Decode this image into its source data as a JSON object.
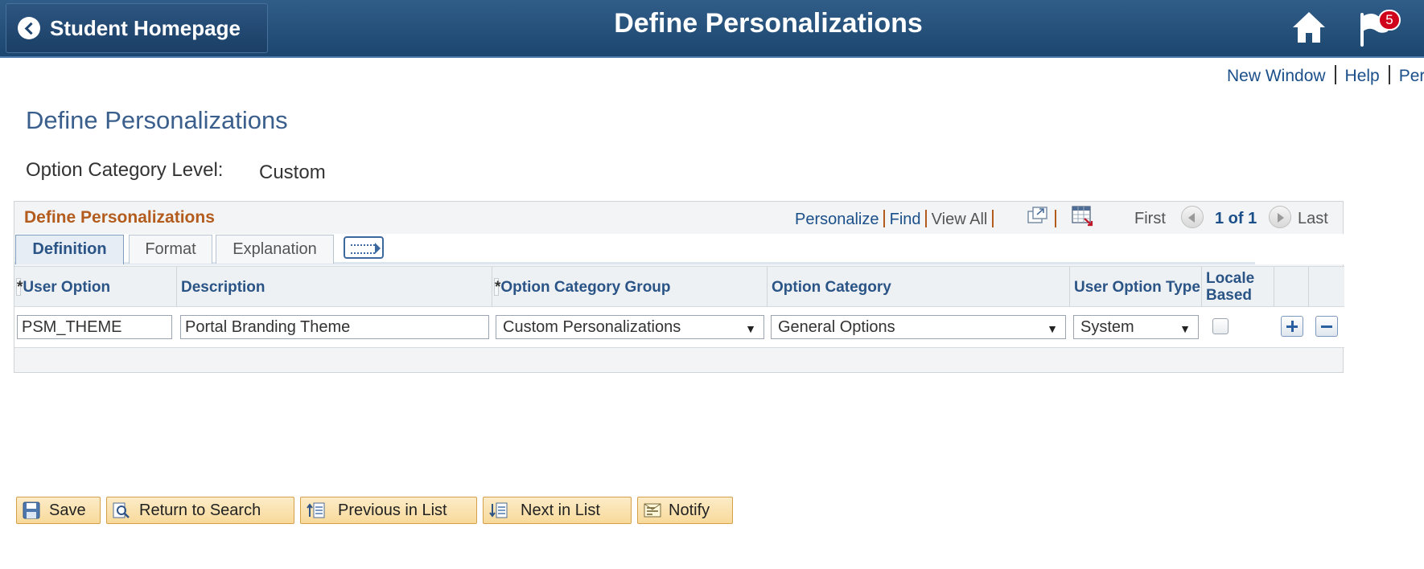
{
  "banner": {
    "back_label": "Student Homepage",
    "title": "Define Personalizations",
    "notification_count": "5"
  },
  "top_links": [
    "New Window",
    "Help",
    "Pers"
  ],
  "page": {
    "title": "Define Personalizations",
    "level_label": "Option Category Level:",
    "level_value": "Custom"
  },
  "grid": {
    "title": "Define Personalizations",
    "nav": {
      "personalize": "Personalize",
      "find": "Find",
      "view_all": "View All",
      "first": "First",
      "range": "1 of 1",
      "last": "Last"
    },
    "tabs": [
      "Definition",
      "Format",
      "Explanation"
    ],
    "active_tab": "Definition",
    "columns": [
      {
        "label": "User Option",
        "required": true
      },
      {
        "label": "Description",
        "required": false
      },
      {
        "label": "Option Category Group",
        "required": true
      },
      {
        "label": "Option Category",
        "required": false
      },
      {
        "label": "User Option Type",
        "required": false
      },
      {
        "label": "Locale Based",
        "required": false
      }
    ],
    "required_marker": "*",
    "rows": [
      {
        "user_option": "PSM_THEME",
        "description": "Portal Branding Theme",
        "option_category_group": "Custom Personalizations",
        "option_category": "General Options",
        "user_option_type": "System",
        "locale_based": false
      }
    ]
  },
  "toolbar": {
    "save": "Save",
    "return_to_search": "Return to Search",
    "previous_in_list": "Previous in List",
    "next_in_list": "Next in List",
    "notify": "Notify"
  },
  "colors": {
    "banner": "#1c466f",
    "link": "#1b4f8a",
    "grid_title": "#b35c1e",
    "toolbar_button": "#f8d99a"
  }
}
